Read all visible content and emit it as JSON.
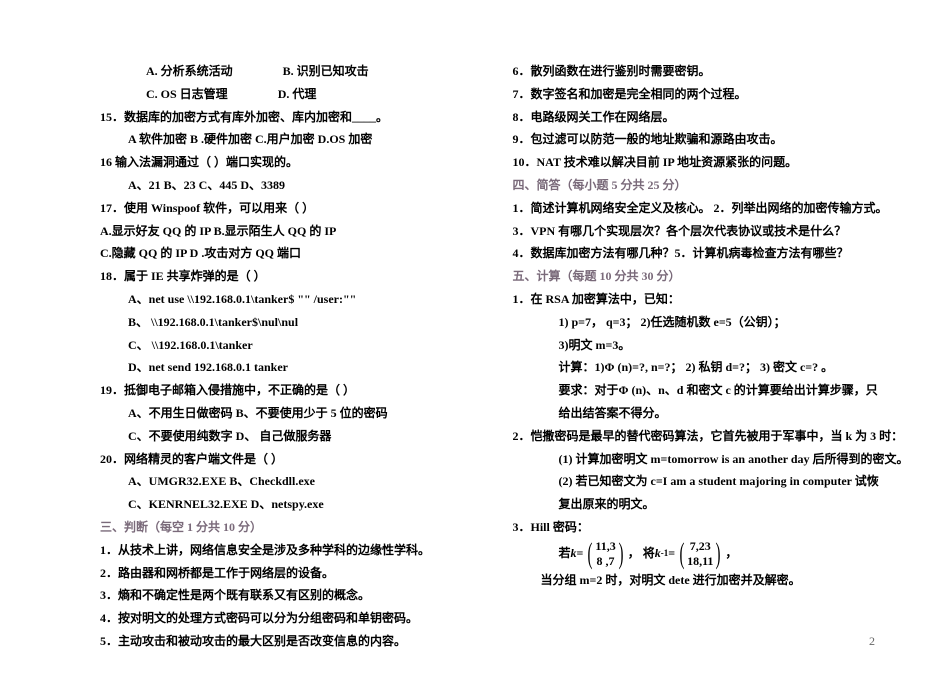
{
  "left": {
    "l1a": "A. 分析系统活动",
    "l1b": "B. 识别已知攻击",
    "l2a": "C. OS 日志管理",
    "l2b": "D. 代理",
    "q15": "15．数据库的加密方式有库外加密、库内加密和____。",
    "q15opts": "A  软件加密    B .硬件加密    C.用户加密    D.OS 加密",
    "q16": "16 输入法漏洞通过（    ）端口实现的。",
    "q16opts": "A、21    B、23    C、445    D、3389",
    "q17": "17．使用 Winspoof 软件，可以用来（    ）",
    "q17a": "A.显示好友 QQ 的 IP       B.显示陌生人 QQ 的 IP",
    "q17b": "C.隐藏 QQ 的 IP     D .攻击对方 QQ 端口",
    "q18": "18．属于 IE 共享炸弹的是（    ）",
    "q18a": "A、net use \\\\192.168.0.1\\tanker$ \"\" /user:\"\"",
    "q18b": "B、 \\\\192.168.0.1\\tanker$\\nul\\nul",
    "q18c": "C、 \\\\192.168.0.1\\tanker",
    "q18d": "D、net  send  192.168.0.1  tanker",
    "q19": "19．抵御电子邮箱入侵措施中，不正确的是（    ）",
    "q19a": "A、不用生日做密码     B、不要使用少于 5 位的密码",
    "q19b": "C、不要使用纯数字      D、 自己做服务器",
    "q20": "20．网络精灵的客户端文件是（    ）",
    "q20a": "A、UMGR32.EXE      B、Checkdll.exe",
    "q20b": "C、KENRNEL32.EXE    D、netspy.exe",
    "sec3": "三、判断（每空 1 分共 10 分）",
    "j1": "1．从技术上讲，网络信息安全是涉及多种学科的边缘性学科。",
    "j2": "2．路由器和网桥都是工作于网络层的设备。",
    "j3": "3．熵和不确定性是两个既有联系又有区别的概念。",
    "j4": "4．按对明文的处理方式密码可以分为分组密码和单钥密码。",
    "j5": "5．主动攻击和被动攻击的最大区别是否改变信息的内容。"
  },
  "right": {
    "j6": "6．散列函数在进行鉴别时需要密钥。",
    "j7": "7．数字签名和加密是完全相同的两个过程。",
    "j8": "8．电路级网关工作在网络层。",
    "j9": "9．包过滤可以防范一般的地址欺骗和源路由攻击。",
    "j10": "10．NAT 技术难以解决目前 IP 地址资源紧张的问题。",
    "sec4": "四、简答（每小题 5 分共 25 分）",
    "s1": "1．简述计算机网络安全定义及核心。  2．列举出网络的加密传输方式。",
    "s3": "3．VPN 有哪几个实现层次？各个层次代表协议或技术是什么？",
    "s4": "4．数据库加密方法有哪几种？5．计算机病毒检查方法有哪些？",
    "sec5": "五、计算（每题 10 分共 30 分）",
    "c1": "1．在 RSA 加密算法中，已知：",
    "c1a": "1)    p=7， q=3；    2)任选随机数 e=5（公钥）；",
    "c1b": "3)明文 m=3。",
    "c1c": "计算：1)Φ (n)=?, n=?；   2) 私钥 d=?；   3) 密文 c=? 。",
    "c1d": "要求：对于Φ (n)、n、d 和密文 c 的计算要给出计算步骤，只给出结答案不得分。",
    "c2": "2．恺撒密码是最早的替代密码算法，它首先被用于军事中，当 k 为 3 时：",
    "c2a": "(1) 计算加密明文 m=tomorrow is an another day  后所得到的密文。",
    "c2b": "(2) 若已知密文为  c=I am a student majoring in computer  试恢复出原来的明文。",
    "c3": "3．Hill 密码：",
    "mat_prefix": "若",
    "mat_k": "k",
    "mat_eq": "=",
    "mat_a11": "11,3",
    "mat_a21": "8 ,7",
    "mat_mid": "， 将",
    "mat_kinv": "k",
    "mat_sup": "-1",
    "mat_b11": "7,23",
    "mat_b21": "18,11",
    "mat_end": "，",
    "c3b": "当分组 m=2 时，对明文 dete 进行加密并及解密。"
  },
  "page_number": "2"
}
